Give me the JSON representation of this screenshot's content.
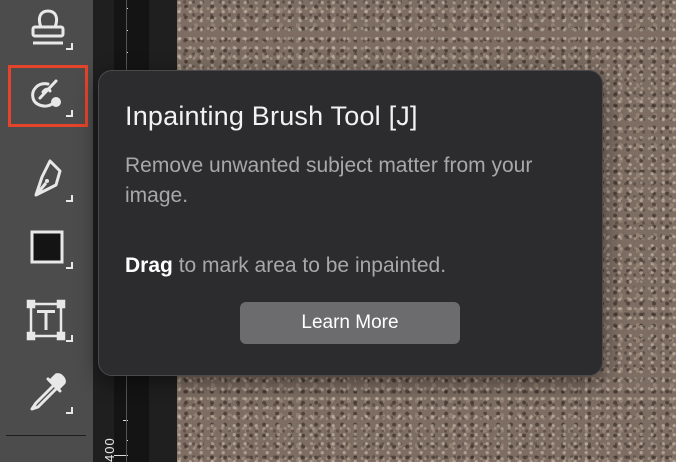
{
  "toolbar": {
    "tools": [
      {
        "icon": "clone-stamp-icon"
      },
      {
        "icon": "inpainting-brush-icon",
        "selected": true
      },
      {
        "icon": "pen-icon"
      },
      {
        "icon": "rectangle-icon"
      },
      {
        "icon": "type-icon"
      },
      {
        "icon": "eyedropper-icon"
      }
    ]
  },
  "ruler": {
    "label": "400"
  },
  "tooltip": {
    "title": "Inpainting Brush Tool [J]",
    "description": "Remove unwanted subject matter from your image.",
    "hint_action": "Drag",
    "hint_text": " to mark area to be inpainted.",
    "button_label": "Learn More"
  },
  "colors": {
    "selection_outline": "#e3442b",
    "tooltip_bg": "#2c2c2e",
    "toolbar_bg": "#4c4c4c"
  }
}
